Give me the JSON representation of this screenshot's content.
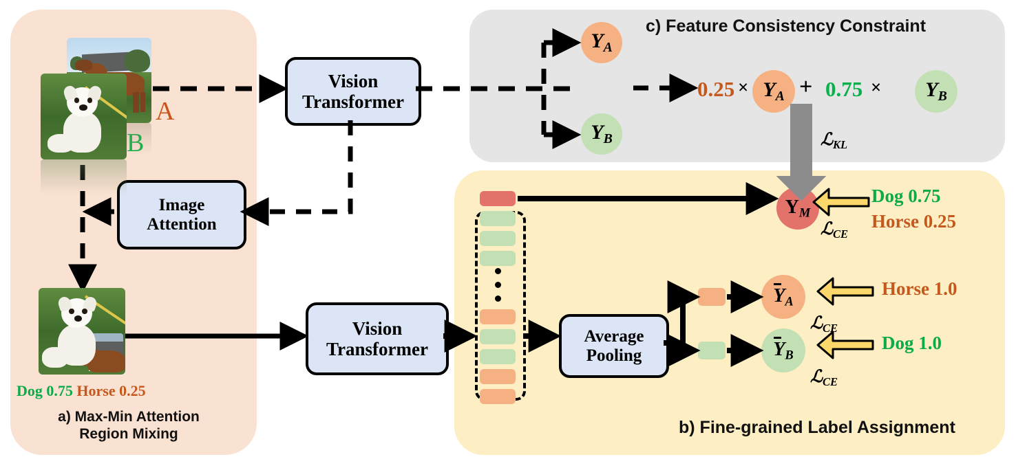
{
  "figure": {
    "type": "architecture-diagram",
    "panels": [
      {
        "id": "a",
        "title": "a) Max-Min Attention\nRegion Mixing",
        "color": "#fae2d2"
      },
      {
        "id": "b",
        "title": "b) Fine-grained Label Assignment",
        "color": "#fdeec4"
      },
      {
        "id": "c",
        "title": "c) Feature Consistency Constraint",
        "color": "#e5e5e5"
      }
    ]
  },
  "panel_a": {
    "title_line1": "a) Max-Min Attention",
    "title_line2": "Region Mixing",
    "image_label_a": "A",
    "image_label_b": "B",
    "image_attention_line1": "Image",
    "image_attention_line2": "Attention",
    "vit_line1": "Vision",
    "vit_line2": "Transformer",
    "mixed_label_dog": "Dog 0.75",
    "mixed_label_horse": "Horse 0.25",
    "photo_top_caption": "horse",
    "photo_front_caption": "dog",
    "photo_mixed_caption": "mixed dog and horse"
  },
  "panel_c": {
    "title": "c) Feature Consistency Constraint",
    "node_ya": {
      "letter": "Y",
      "sub": "A"
    },
    "node_yb": {
      "letter": "Y",
      "sub": "B"
    },
    "expression": {
      "weight_a": "0.25",
      "times1": "×",
      "term_a": {
        "letter": "Y",
        "sub": "A"
      },
      "plus": "+",
      "weight_b": "0.75",
      "times2": "×",
      "term_b": {
        "letter": "Y",
        "sub": "B"
      }
    },
    "colors": {
      "weight_a": "#c4581d",
      "weight_b": "#09b04c",
      "circle_a": "#f6b183",
      "circle_b": "#c2e0b4"
    }
  },
  "panel_b": {
    "title": "b) Fine-grained Label Assignment",
    "vit_line1": "Vision",
    "vit_line2": "Transformer",
    "avgpool_line1": "Average",
    "avgpool_line2": "Pooling",
    "node_ym": {
      "letter": "Y",
      "sub": "M"
    },
    "node_ybar_a": {
      "letter": "Y",
      "sub": "A"
    },
    "node_ybar_b": {
      "letter": "Y",
      "sub": "B"
    },
    "gt_ym_line1": "Dog 0.75",
    "gt_ym_line2": "Horse 0.25",
    "gt_ybar_a": "Horse 1.0",
    "gt_ybar_b": "Dog 1.0",
    "tokens": [
      {
        "color": "#e3726b",
        "name": "cls-token"
      },
      {
        "color": "#c2e0b4",
        "name": "token-b"
      },
      {
        "color": "#c2e0b4",
        "name": "token-b"
      },
      {
        "color": "#c2e0b4",
        "name": "token-b"
      },
      {
        "color": "#f6b183",
        "name": "token-a"
      },
      {
        "color": "#c2e0b4",
        "name": "token-b"
      },
      {
        "color": "#c2e0b4",
        "name": "token-b"
      },
      {
        "color": "#f6b183",
        "name": "token-a"
      },
      {
        "color": "#f6b183",
        "name": "token-a"
      }
    ]
  },
  "losses": {
    "kl": "ℒ",
    "kl_sub": "KL",
    "ce": "ℒ",
    "ce_sub": "CE"
  },
  "colors": {
    "orange_text": "#c4581d",
    "green_text": "#09b04c",
    "panel_a_bg": "#fae2d2",
    "panel_b_bg": "#fdeec4",
    "panel_c_bg": "#e5e5e5",
    "box_fill": "#dbe5f5",
    "circle_orange": "#f6b183",
    "circle_green": "#c2e0b4",
    "circle_red": "#e3726b",
    "arrow_yellow": "#fcd86a",
    "arrow_gray": "#8c8c8c"
  }
}
